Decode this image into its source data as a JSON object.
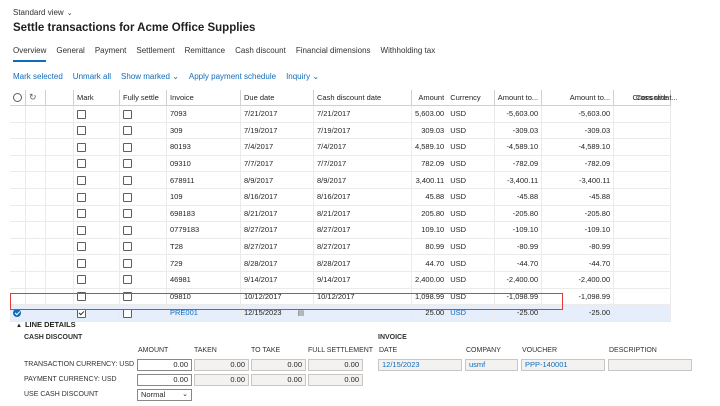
{
  "view": {
    "label": "Standard view"
  },
  "title": "Settle transactions for Acme Office Supplies",
  "tabs": [
    "Overview",
    "General",
    "Payment",
    "Settlement",
    "Remittance",
    "Cash discount",
    "Financial dimensions",
    "Withholding tax"
  ],
  "actions": {
    "mark_selected": "Mark selected",
    "unmark_all": "Unmark all",
    "show_marked": "Show marked",
    "apply_payment_schedule": "Apply payment schedule",
    "inquiry": "Inquiry"
  },
  "grid": {
    "columns": {
      "mark": "Mark",
      "fully_settle": "Fully settle",
      "invoice": "Invoice",
      "due_date": "Due date",
      "cash_discount_date": "Cash discount date",
      "amount": "Amount",
      "currency": "Currency",
      "amount_to1": "Amount to...",
      "amount_to2": "Amount to...",
      "cross_rate": "Cross rate",
      "consolidat": "Consolidat..."
    },
    "rows": [
      {
        "invoice": "7093",
        "due": "7/21/2017",
        "cdd": "7/21/2017",
        "amount": "5,603.00",
        "cur": "USD",
        "a1": "-5,603.00",
        "a2": "-5,603.00"
      },
      {
        "invoice": "309",
        "due": "7/19/2017",
        "cdd": "7/19/2017",
        "amount": "309.03",
        "cur": "USD",
        "a1": "-309.03",
        "a2": "-309.03"
      },
      {
        "invoice": "80193",
        "due": "7/4/2017",
        "cdd": "7/4/2017",
        "amount": "4,589.10",
        "cur": "USD",
        "a1": "-4,589.10",
        "a2": "-4,589.10"
      },
      {
        "invoice": "09310",
        "due": "7/7/2017",
        "cdd": "7/7/2017",
        "amount": "782.09",
        "cur": "USD",
        "a1": "-782.09",
        "a2": "-782.09"
      },
      {
        "invoice": "678911",
        "due": "8/9/2017",
        "cdd": "8/9/2017",
        "amount": "3,400.11",
        "cur": "USD",
        "a1": "-3,400.11",
        "a2": "-3,400.11"
      },
      {
        "invoice": "109",
        "due": "8/16/2017",
        "cdd": "8/16/2017",
        "amount": "45.88",
        "cur": "USD",
        "a1": "-45.88",
        "a2": "-45.88"
      },
      {
        "invoice": "698183",
        "due": "8/21/2017",
        "cdd": "8/21/2017",
        "amount": "205.80",
        "cur": "USD",
        "a1": "-205.80",
        "a2": "-205.80"
      },
      {
        "invoice": "0779183",
        "due": "8/27/2017",
        "cdd": "8/27/2017",
        "amount": "109.10",
        "cur": "USD",
        "a1": "-109.10",
        "a2": "-109.10"
      },
      {
        "invoice": "T28",
        "due": "8/27/2017",
        "cdd": "8/27/2017",
        "amount": "80.99",
        "cur": "USD",
        "a1": "-80.99",
        "a2": "-80.99"
      },
      {
        "invoice": "729",
        "due": "8/28/2017",
        "cdd": "8/28/2017",
        "amount": "44.70",
        "cur": "USD",
        "a1": "-44.70",
        "a2": "-44.70"
      },
      {
        "invoice": "46981",
        "due": "9/14/2017",
        "cdd": "9/14/2017",
        "amount": "2,400.00",
        "cur": "USD",
        "a1": "-2,400.00",
        "a2": "-2,400.00"
      },
      {
        "invoice": "09810",
        "due": "10/12/2017",
        "cdd": "10/12/2017",
        "amount": "1,098.99",
        "cur": "USD",
        "a1": "-1,098.99",
        "a2": "-1,098.99"
      }
    ],
    "selected_row": {
      "invoice": "PRE001",
      "due": "12/15/2023",
      "cdd": "",
      "amount": "25.00",
      "cur": "USD",
      "a1": "-25.00",
      "a2": "-25.00"
    }
  },
  "line_details": {
    "header": "LINE DETAILS",
    "cash_discount": {
      "title": "CASH DISCOUNT",
      "col_amount": "AMOUNT",
      "col_taken": "TAKEN",
      "col_to_take": "TO TAKE",
      "col_full": "FULL SETTLEMENT",
      "row1_label": "TRANSACTION CURRENCY: USD",
      "row2_label": "PAYMENT CURRENCY: USD",
      "use_label": "USE CASH DISCOUNT",
      "row1": [
        "0.00",
        "0.00",
        "0.00",
        "0.00"
      ],
      "row2": [
        "0.00",
        "0.00",
        "0.00",
        "0.00"
      ],
      "use_value": "Normal"
    },
    "invoice": {
      "title": "INVOICE",
      "col_date": "DATE",
      "col_company": "COMPANY",
      "col_voucher": "VOUCHER",
      "col_desc": "DESCRIPTION",
      "date": "12/15/2023",
      "company": "usmf",
      "voucher": "PPP-140001",
      "description": ""
    }
  }
}
